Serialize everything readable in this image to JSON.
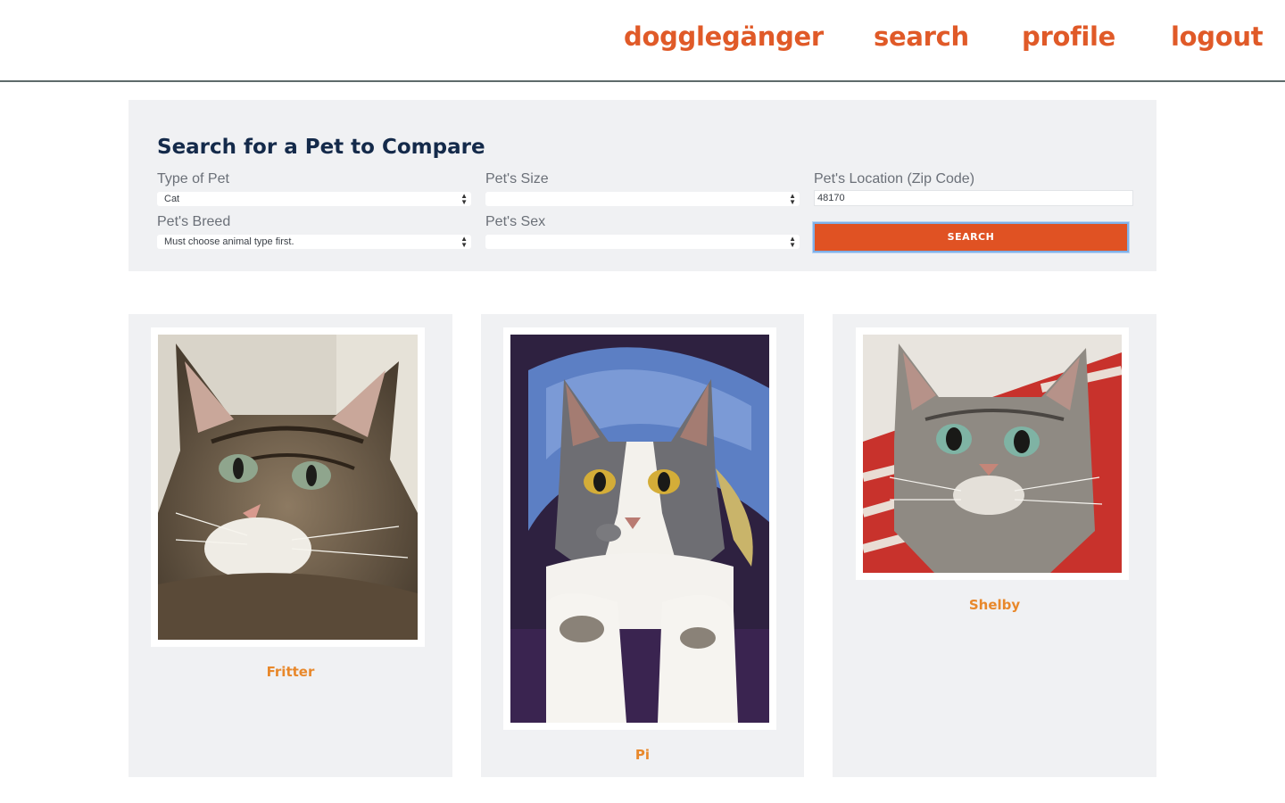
{
  "nav": {
    "brand": "dogglegänger",
    "search": "search",
    "profile": "profile",
    "logout": "logout"
  },
  "search_form": {
    "title": "Search for a Pet to Compare",
    "type_label": "Type of Pet",
    "type_value": "Cat",
    "size_label": "Pet's Size",
    "size_value": "",
    "location_label": "Pet's Location (Zip Code)",
    "location_value": "48170",
    "breed_label": "Pet's Breed",
    "breed_value": "Must choose animal type first.",
    "sex_label": "Pet's Sex",
    "sex_value": "",
    "button_label": "SEARCH"
  },
  "results": [
    {
      "name": "Fritter",
      "photo": "tabby-cat-photo"
    },
    {
      "name": "Pi",
      "photo": "gray-white-cat-photo"
    },
    {
      "name": "Shelby",
      "photo": "gray-tabby-cat-photo"
    }
  ],
  "colors": {
    "accent": "#e05a28",
    "button": "#e05223",
    "pet_name": "#e8882b",
    "panel_bg": "#f0f1f3",
    "title": "#142a4a"
  }
}
